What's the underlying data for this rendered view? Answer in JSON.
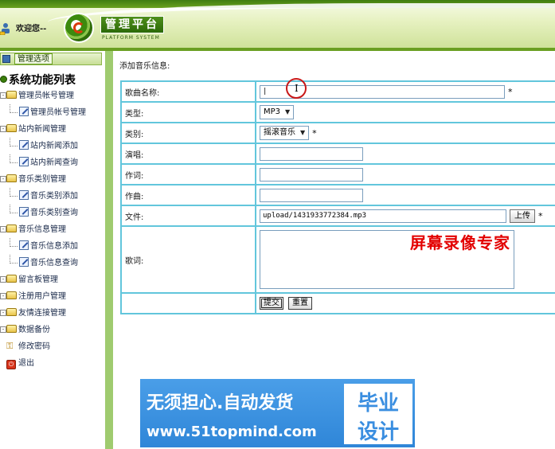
{
  "header": {
    "welcome": "欢迎您--",
    "title": "管理平台",
    "subtitle": "PLATFORM SYSTEM"
  },
  "sidebar": {
    "panel_label": "管理选项",
    "root_label": "系统功能列表",
    "items": [
      {
        "type": "group",
        "label": "管理员帐号管理"
      },
      {
        "type": "child",
        "label": "管理员帐号管理"
      },
      {
        "type": "group",
        "label": "站内新闻管理"
      },
      {
        "type": "child",
        "label": "站内新闻添加"
      },
      {
        "type": "child",
        "label": "站内新闻查询"
      },
      {
        "type": "group",
        "label": "音乐类别管理"
      },
      {
        "type": "child",
        "label": "音乐类别添加"
      },
      {
        "type": "child",
        "label": "音乐类别查询"
      },
      {
        "type": "group",
        "label": "音乐信息管理"
      },
      {
        "type": "child",
        "label": "音乐信息添加"
      },
      {
        "type": "child",
        "label": "音乐信息查询"
      },
      {
        "type": "group",
        "label": "留言板管理"
      },
      {
        "type": "group",
        "label": "注册用户管理"
      },
      {
        "type": "group",
        "label": "友情连接管理"
      },
      {
        "type": "group",
        "label": "数据备份"
      },
      {
        "type": "key",
        "label": "修改密码"
      },
      {
        "type": "exit",
        "label": "退出"
      }
    ]
  },
  "form": {
    "title": "添加音乐信息:",
    "required_mark": "*",
    "rows": {
      "song_name": {
        "label": "歌曲名称:",
        "value": "|"
      },
      "format": {
        "label": "类型:",
        "value": "MP3"
      },
      "category": {
        "label": "类别:",
        "value": "摇滚音乐"
      },
      "singer": {
        "label": "演唱:",
        "value": ""
      },
      "lyricist": {
        "label": "作词:",
        "value": ""
      },
      "composer": {
        "label": "作曲:",
        "value": ""
      },
      "file": {
        "label": "文件:",
        "value": "upload/1431933772384.mp3",
        "upload_label": "上传"
      },
      "lyrics": {
        "label": "歌词:",
        "value": ""
      }
    },
    "submit_label": "提交",
    "reset_label": "重置"
  },
  "overlay": {
    "watermark": "屏幕录像专家",
    "cursor_glyph": "I"
  },
  "banner": {
    "line1": "无须担心.自动发货",
    "line2": "www.51topmind.com",
    "box_line1": "毕业",
    "box_line2": "设计"
  }
}
